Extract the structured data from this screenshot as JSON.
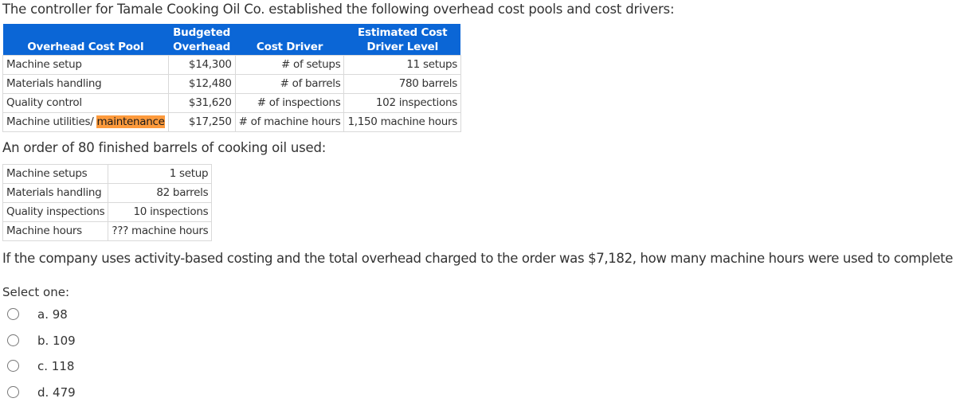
{
  "intro": "The controller for Tamale Cooking Oil Co. established the following overhead cost pools and cost drivers:",
  "colors": {
    "header_bg": "#0b66d6",
    "highlight": "#fd9a3c"
  },
  "cost_table": {
    "headers": [
      "Overhead Cost Pool",
      "Budgeted Overhead",
      "Cost Driver",
      "Estimated Cost Driver Level"
    ],
    "header_lines": {
      "pool": [
        "",
        "Overhead Cost Pool"
      ],
      "overhead": [
        "Budgeted",
        "Overhead"
      ],
      "driver": [
        "",
        "Cost Driver"
      ],
      "level": [
        "Estimated Cost",
        "Driver Level"
      ]
    },
    "rows": [
      {
        "pool": "Machine setup",
        "overhead": "$14,300",
        "driver": "# of setups",
        "level": "11 setups"
      },
      {
        "pool": "Materials handling",
        "overhead": "$12,480",
        "driver": "# of barrels",
        "level": "780 barrels"
      },
      {
        "pool": "Quality control",
        "overhead": "$31,620",
        "driver": "# of inspections",
        "level": "102 inspections"
      },
      {
        "pool": "Machine utilities/ ",
        "pool_highlight": "maintenance",
        "overhead": "$17,250",
        "driver": "# of machine hours",
        "level": "1,150 machine hours"
      }
    ]
  },
  "order_intro": "An order of 80 finished barrels of cooking oil used:",
  "order_table": {
    "rows": [
      {
        "label": "Machine setups",
        "value": "1 setup"
      },
      {
        "label": "Materials handling",
        "value": "82 barrels"
      },
      {
        "label": "Quality inspections",
        "value": "10 inspections"
      },
      {
        "label": "Machine hours",
        "value": "??? machine hours"
      }
    ]
  },
  "question": "If the company uses activity-based costing and the total overhead charged to the order was $7,182, how many machine hours were used to complete the order?",
  "select_label": "Select one:",
  "options": [
    {
      "label": "a. 98",
      "selected": false
    },
    {
      "label": "b. 109",
      "selected": false
    },
    {
      "label": "c. 118",
      "selected": false
    },
    {
      "label": "d. 479",
      "selected": false
    }
  ]
}
